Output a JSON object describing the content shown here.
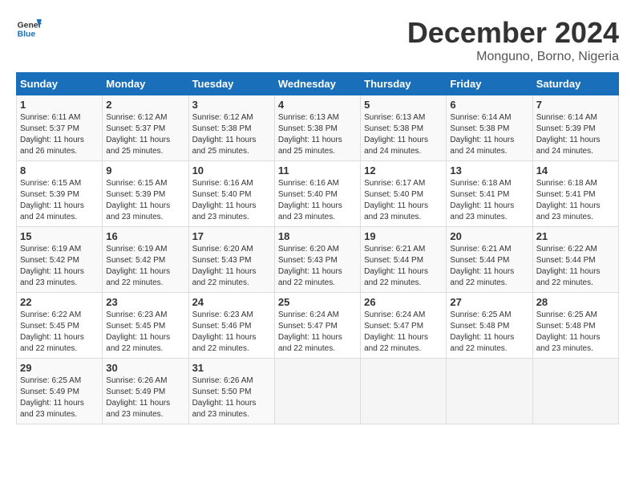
{
  "header": {
    "logo_line1": "General",
    "logo_line2": "Blue",
    "month": "December 2024",
    "location": "Monguno, Borno, Nigeria"
  },
  "days_of_week": [
    "Sunday",
    "Monday",
    "Tuesday",
    "Wednesday",
    "Thursday",
    "Friday",
    "Saturday"
  ],
  "weeks": [
    [
      {
        "day": "1",
        "sunrise": "6:11 AM",
        "sunset": "5:37 PM",
        "daylight": "11 hours and 26 minutes."
      },
      {
        "day": "2",
        "sunrise": "6:12 AM",
        "sunset": "5:37 PM",
        "daylight": "11 hours and 25 minutes."
      },
      {
        "day": "3",
        "sunrise": "6:12 AM",
        "sunset": "5:38 PM",
        "daylight": "11 hours and 25 minutes."
      },
      {
        "day": "4",
        "sunrise": "6:13 AM",
        "sunset": "5:38 PM",
        "daylight": "11 hours and 25 minutes."
      },
      {
        "day": "5",
        "sunrise": "6:13 AM",
        "sunset": "5:38 PM",
        "daylight": "11 hours and 24 minutes."
      },
      {
        "day": "6",
        "sunrise": "6:14 AM",
        "sunset": "5:38 PM",
        "daylight": "11 hours and 24 minutes."
      },
      {
        "day": "7",
        "sunrise": "6:14 AM",
        "sunset": "5:39 PM",
        "daylight": "11 hours and 24 minutes."
      }
    ],
    [
      {
        "day": "8",
        "sunrise": "6:15 AM",
        "sunset": "5:39 PM",
        "daylight": "11 hours and 24 minutes."
      },
      {
        "day": "9",
        "sunrise": "6:15 AM",
        "sunset": "5:39 PM",
        "daylight": "11 hours and 23 minutes."
      },
      {
        "day": "10",
        "sunrise": "6:16 AM",
        "sunset": "5:40 PM",
        "daylight": "11 hours and 23 minutes."
      },
      {
        "day": "11",
        "sunrise": "6:16 AM",
        "sunset": "5:40 PM",
        "daylight": "11 hours and 23 minutes."
      },
      {
        "day": "12",
        "sunrise": "6:17 AM",
        "sunset": "5:40 PM",
        "daylight": "11 hours and 23 minutes."
      },
      {
        "day": "13",
        "sunrise": "6:18 AM",
        "sunset": "5:41 PM",
        "daylight": "11 hours and 23 minutes."
      },
      {
        "day": "14",
        "sunrise": "6:18 AM",
        "sunset": "5:41 PM",
        "daylight": "11 hours and 23 minutes."
      }
    ],
    [
      {
        "day": "15",
        "sunrise": "6:19 AM",
        "sunset": "5:42 PM",
        "daylight": "11 hours and 23 minutes."
      },
      {
        "day": "16",
        "sunrise": "6:19 AM",
        "sunset": "5:42 PM",
        "daylight": "11 hours and 22 minutes."
      },
      {
        "day": "17",
        "sunrise": "6:20 AM",
        "sunset": "5:43 PM",
        "daylight": "11 hours and 22 minutes."
      },
      {
        "day": "18",
        "sunrise": "6:20 AM",
        "sunset": "5:43 PM",
        "daylight": "11 hours and 22 minutes."
      },
      {
        "day": "19",
        "sunrise": "6:21 AM",
        "sunset": "5:44 PM",
        "daylight": "11 hours and 22 minutes."
      },
      {
        "day": "20",
        "sunrise": "6:21 AM",
        "sunset": "5:44 PM",
        "daylight": "11 hours and 22 minutes."
      },
      {
        "day": "21",
        "sunrise": "6:22 AM",
        "sunset": "5:44 PM",
        "daylight": "11 hours and 22 minutes."
      }
    ],
    [
      {
        "day": "22",
        "sunrise": "6:22 AM",
        "sunset": "5:45 PM",
        "daylight": "11 hours and 22 minutes."
      },
      {
        "day": "23",
        "sunrise": "6:23 AM",
        "sunset": "5:45 PM",
        "daylight": "11 hours and 22 minutes."
      },
      {
        "day": "24",
        "sunrise": "6:23 AM",
        "sunset": "5:46 PM",
        "daylight": "11 hours and 22 minutes."
      },
      {
        "day": "25",
        "sunrise": "6:24 AM",
        "sunset": "5:47 PM",
        "daylight": "11 hours and 22 minutes."
      },
      {
        "day": "26",
        "sunrise": "6:24 AM",
        "sunset": "5:47 PM",
        "daylight": "11 hours and 22 minutes."
      },
      {
        "day": "27",
        "sunrise": "6:25 AM",
        "sunset": "5:48 PM",
        "daylight": "11 hours and 22 minutes."
      },
      {
        "day": "28",
        "sunrise": "6:25 AM",
        "sunset": "5:48 PM",
        "daylight": "11 hours and 23 minutes."
      }
    ],
    [
      {
        "day": "29",
        "sunrise": "6:25 AM",
        "sunset": "5:49 PM",
        "daylight": "11 hours and 23 minutes."
      },
      {
        "day": "30",
        "sunrise": "6:26 AM",
        "sunset": "5:49 PM",
        "daylight": "11 hours and 23 minutes."
      },
      {
        "day": "31",
        "sunrise": "6:26 AM",
        "sunset": "5:50 PM",
        "daylight": "11 hours and 23 minutes."
      },
      null,
      null,
      null,
      null
    ]
  ]
}
